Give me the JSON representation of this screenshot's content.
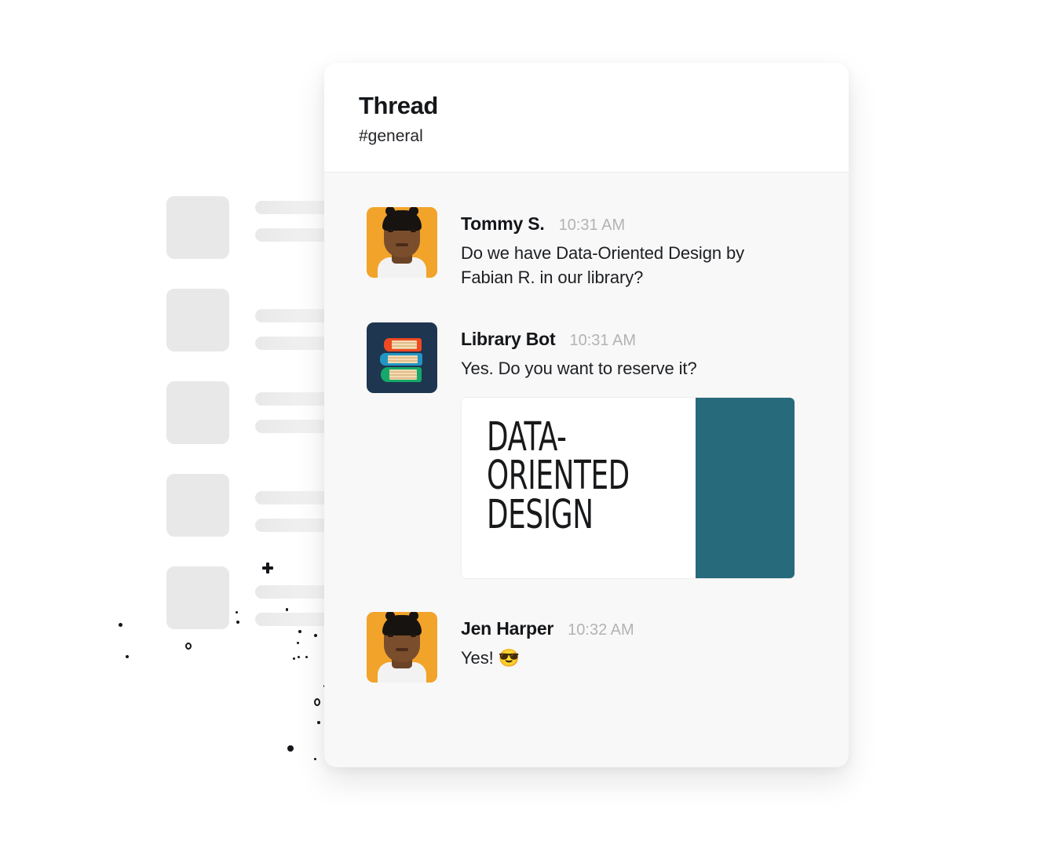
{
  "header": {
    "title": "Thread",
    "channel": "#general"
  },
  "messages": [
    {
      "author": "Tommy S.",
      "time": "10:31 AM",
      "text": "Do we have Data-Oriented Design by Fabian R. in our library?",
      "avatar_kind": "person-photo",
      "avatar_color": "#f2a32a"
    },
    {
      "author": "Library Bot",
      "time": "10:31 AM",
      "text": "Yes. Do you want to reserve it?",
      "avatar_kind": "books-icon",
      "avatar_color": "#1f3650"
    },
    {
      "author": "Jen Harper",
      "time": "10:32 AM",
      "text": "Yes! 😎",
      "avatar_kind": "person-photo",
      "avatar_color": "#f2a32a"
    }
  ],
  "attachment": {
    "cover_title": "DATA-\nORIENTED\nDESIGN",
    "spine_color": "#266a7c",
    "front_color": "#ffffff"
  },
  "background": {
    "skeleton_rows": 5,
    "thumb_color": "#e8e8e8",
    "bar_color": "#e9e9e9"
  },
  "colors": {
    "card_background": "#f8f8f8",
    "header_background": "#ffffff",
    "text_primary": "#141619",
    "text_timestamp": "#b3b3b3",
    "accent_orange": "#f2a32a",
    "accent_navy": "#1f3650",
    "accent_teal": "#266a7c"
  }
}
